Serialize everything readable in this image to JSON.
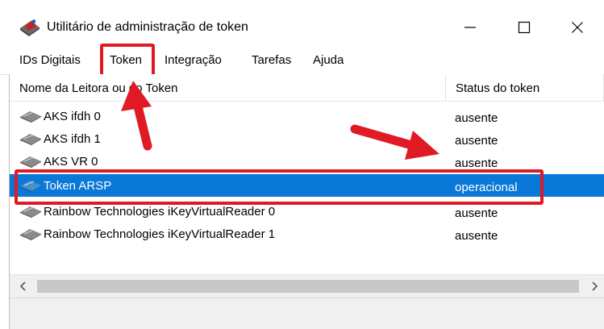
{
  "window": {
    "title": "Utilitário de administração de token",
    "controls": {
      "minimize": "minimize-icon",
      "maximize": "maximize-icon",
      "close": "close-icon"
    }
  },
  "menu": {
    "items": [
      {
        "label": "IDs Digitais"
      },
      {
        "label": "Token"
      },
      {
        "label": "Integração"
      },
      {
        "label": "Tarefas"
      },
      {
        "label": "Ajuda"
      }
    ],
    "highlighted": "Token"
  },
  "list": {
    "columns": {
      "name": "Nome da Leitora ou do Token",
      "status": "Status do token"
    },
    "rows": [
      {
        "name": "AKS ifdh 0",
        "status": "ausente",
        "icon": "card-reader-icon",
        "selected": false
      },
      {
        "name": "AKS ifdh 1",
        "status": "ausente",
        "icon": "card-reader-icon",
        "selected": false
      },
      {
        "name": "AKS VR 0",
        "status": "ausente",
        "icon": "card-reader-icon",
        "selected": false
      },
      {
        "name": "Token ARSP",
        "status": "operacional",
        "icon": "token-icon",
        "selected": true
      },
      {
        "name": "Rainbow Technologies iKeyVirtualReader 0",
        "status": "ausente",
        "icon": "card-reader-icon",
        "selected": false
      },
      {
        "name": "Rainbow Technologies iKeyVirtualReader 1",
        "status": "ausente",
        "icon": "card-reader-icon",
        "selected": false
      }
    ]
  },
  "scrollbar": {
    "left": "scroll-left-icon",
    "right": "scroll-right-icon"
  },
  "colors": {
    "selection": "#0a78d7",
    "annotation": "#e01a24"
  }
}
